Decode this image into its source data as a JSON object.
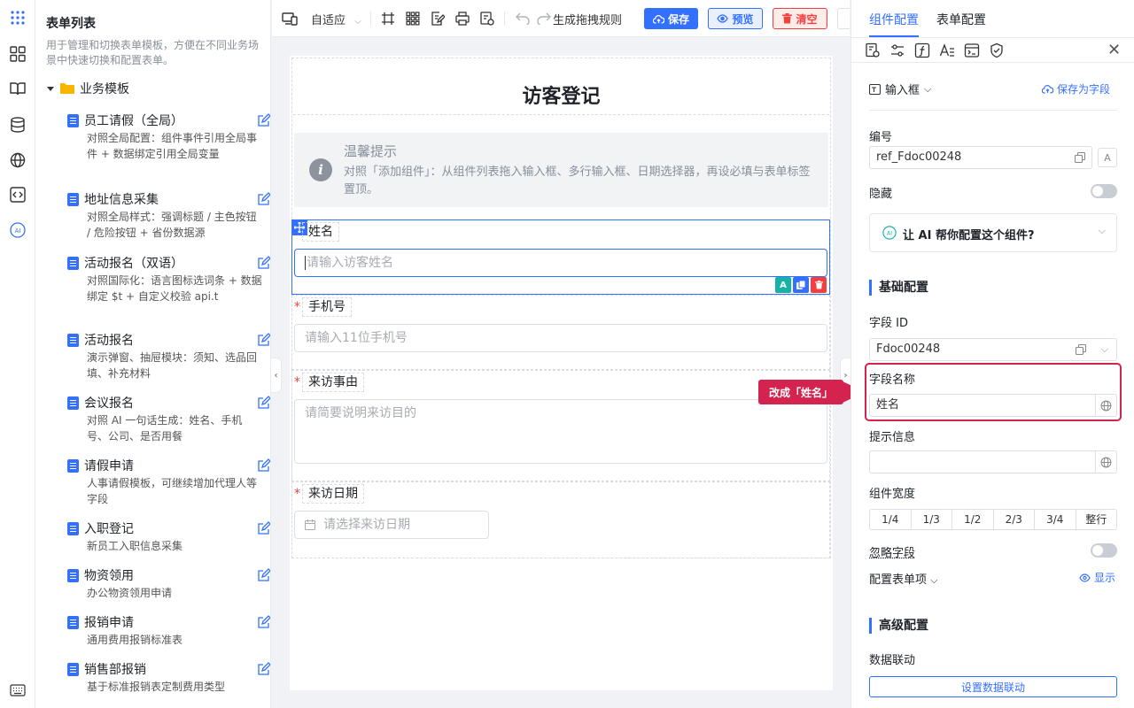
{
  "sidebar": {
    "title": "表单列表",
    "description": "用于管理和切换表单模板，方便在不同业务场景中快速切换和配置表单。",
    "folder": "业务模板",
    "items": [
      {
        "title": "员工请假（全局）",
        "desc": "对照全局配置：组件事件引用全局事件 + 数据绑定引用全局变量"
      },
      {
        "title": "地址信息采集",
        "desc": "对照全局样式：强调标题 / 主色按钮 / 危险按钮 + 省份数据源"
      },
      {
        "title": "活动报名（双语）",
        "desc": "对照国际化：语言图标选词条 + 数据绑定 $t + 自定义校验 api.t"
      },
      {
        "title": "活动报名",
        "desc": "演示弹窗、抽屉模块：须知、选品回填、补充材料"
      },
      {
        "title": "会议报名",
        "desc": "对照 AI 一句话生成：姓名、手机号、公司、是否用餐"
      },
      {
        "title": "请假申请",
        "desc": "人事请假模板，可继续增加代理人等字段"
      },
      {
        "title": "入职登记",
        "desc": "新员工入职信息采集"
      },
      {
        "title": "物资领用",
        "desc": "办公物资领用申请"
      },
      {
        "title": "报销申请",
        "desc": "通用费用报销标准表"
      },
      {
        "title": "销售部报销",
        "desc": "基于标准报销表定制费用类型"
      }
    ]
  },
  "toolbar": {
    "device": "自适应",
    "rule_label": "生成拖拽规则",
    "save": "保存",
    "preview": "预览",
    "clear": "清空"
  },
  "canvas": {
    "form_title": "访客登记",
    "tip_title": "温馨提示",
    "tip_text": "对照「添加组件」：从组件列表拖入输入框、多行输入框、日期选择器，再设必填与表单标签置顶。",
    "fields": [
      {
        "label": "姓名",
        "placeholder": "请输入访客姓名"
      },
      {
        "label": "手机号",
        "placeholder": "请输入11位手机号"
      },
      {
        "label": "来访事由",
        "placeholder": "请简要说明来访目的"
      },
      {
        "label": "来访日期",
        "placeholder": "请选择来访日期"
      }
    ],
    "required_mark": "*"
  },
  "panel": {
    "tab_component": "组件配置",
    "tab_form": "表单配置",
    "component_type": "输入框",
    "save_as_field": "保存为字段",
    "id_label": "编号",
    "id_value": "ref_Fdoc00248",
    "hidden_label": "隐藏",
    "ai_prompt": "让 AI 帮你配置这个组件?",
    "basic_section": "基础配置",
    "field_id_label": "字段 ID",
    "field_id_value": "Fdoc00248",
    "field_name_label": "字段名称",
    "field_name_value": "姓名",
    "hint_label": "提示信息",
    "hint_value": "",
    "width_label": "组件宽度",
    "width_options": [
      "1/4",
      "1/3",
      "1/2",
      "2/3",
      "3/4",
      "整行"
    ],
    "ignore_label": "忽略字段",
    "form_item_label": "配置表单项",
    "show_label": "显示",
    "advanced_section": "高级配置",
    "linkage_label": "数据联动",
    "linkage_button": "设置数据联动"
  },
  "callout": "改成「姓名」",
  "colors": {
    "accent": "#3370ff",
    "danger": "#f53f3f",
    "highlight": "#d4234f"
  }
}
